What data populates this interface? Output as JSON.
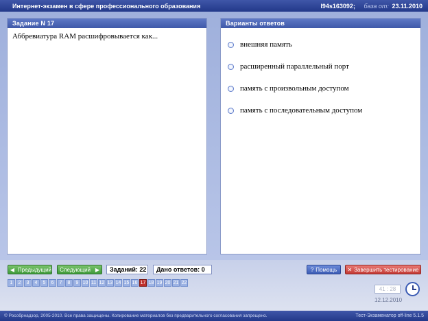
{
  "header": {
    "title": "Интернет-экзамен в сфере профессионального образования",
    "id": "l94s163092;",
    "base_label": "база от:",
    "base_date": "23.11.2010"
  },
  "task": {
    "panel_title": "Задание N 17",
    "question": "Аббревиатура RAM расшифровывается как..."
  },
  "answers": {
    "panel_title": "Варианты ответов",
    "options": [
      "внешняя память",
      "расширенный параллельный порт",
      "память с произвольным доступом",
      "память с последовательным доступом"
    ]
  },
  "nav": {
    "prev_label": "Предыдущий",
    "next_label": "Следующий",
    "tasks_count": "Заданий: 22",
    "answers_count": "Дано ответов: 0",
    "help_label": "Помощь",
    "finish_label": "Завершить тестирование",
    "numbers": [
      "1",
      "2",
      "3",
      "4",
      "5",
      "6",
      "7",
      "8",
      "9",
      "10",
      "11",
      "12",
      "13",
      "14",
      "15",
      "16",
      "17",
      "18",
      "19",
      "20",
      "21",
      "22"
    ],
    "current": "17"
  },
  "status": {
    "timer": "41 : 28",
    "date": "12.12.2010"
  },
  "footer": {
    "copyright": "© Рособрнадзор, 2005-2010. Все права защищены. Копирование материалов без предварительного согласования запрещено.",
    "version": "Тест-Экзаменатор off-line 5.1.5"
  },
  "icons": {
    "prev": "arrow-left-icon",
    "next": "arrow-right-icon",
    "help": "question-icon",
    "finish": "runner-icon",
    "clock": "clock-icon"
  }
}
